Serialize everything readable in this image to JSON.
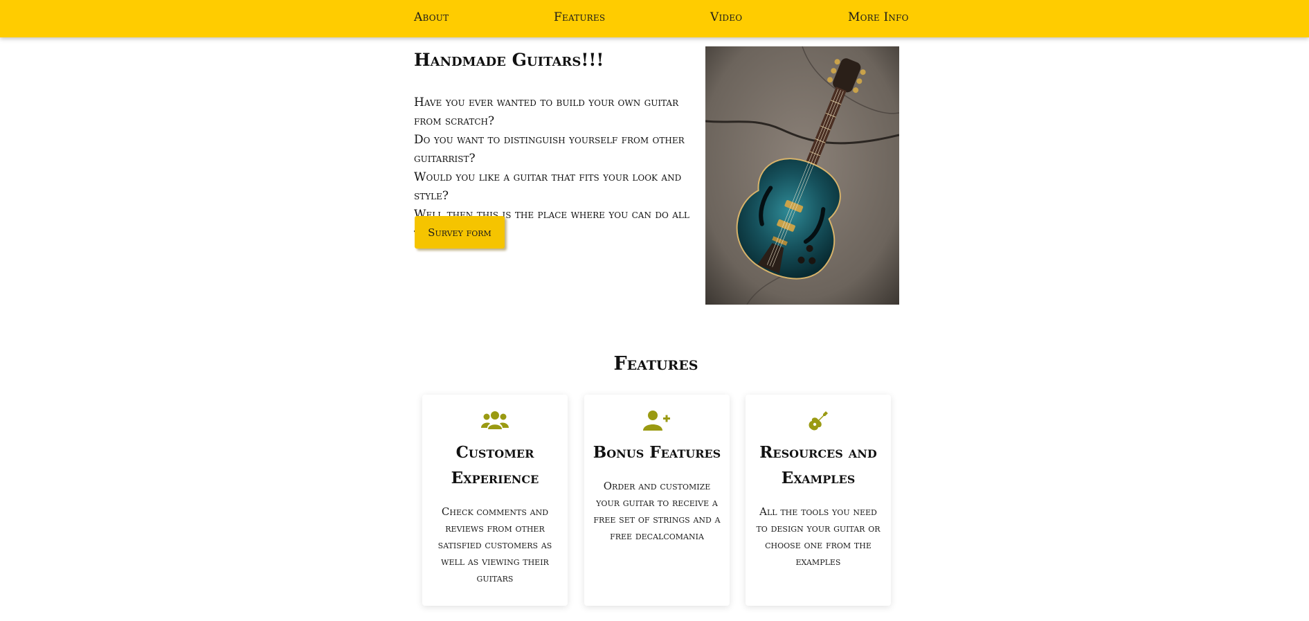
{
  "nav": {
    "items": [
      {
        "label": "About"
      },
      {
        "label": "Features"
      },
      {
        "label": "Video"
      },
      {
        "label": "More Info"
      }
    ]
  },
  "hero": {
    "title": "Handmade Guitars!!!",
    "lines": [
      "Have you ever wanted to build your own guitar from scratch?",
      "Do you want to distinguish yourself from other guitarrist?",
      "Would you like a guitar that fits your look and style?",
      "Well then this is the place where you can do all this!"
    ],
    "button_label": "Survey form",
    "image_icon": "guitar-photo"
  },
  "features": {
    "title": "Features",
    "cards": [
      {
        "icon": "users-icon",
        "title": "Customer Experience",
        "text": "Check comments and reviews from other satisfied customers as well as viewing their guitars"
      },
      {
        "icon": "user-plus-icon",
        "title": "Bonus Features",
        "text": "Order and customize your guitar to receive a free set of strings and a free decalcomania"
      },
      {
        "icon": "guitar-icon",
        "title": "Resources and Examples",
        "text": "All the tools you need to design your guitar or choose one from the examples"
      }
    ]
  },
  "colors": {
    "nav_bg": "#ffcc00",
    "button_bg": "#f5c400",
    "icon": "#9a9a12"
  }
}
